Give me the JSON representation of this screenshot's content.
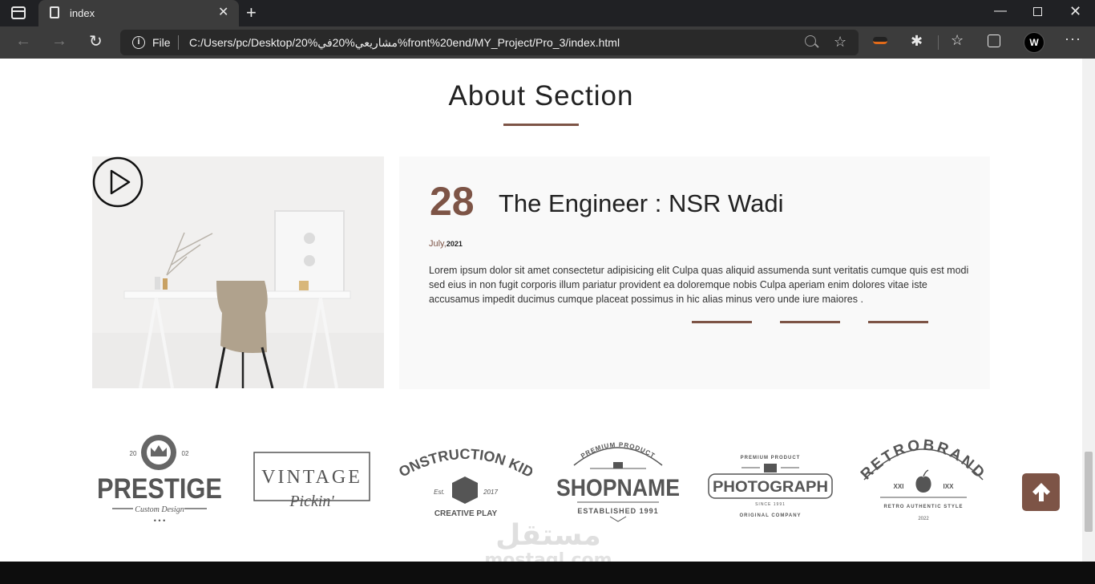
{
  "browser": {
    "tab_title": "index",
    "site_label": "File",
    "url": "C:/Users/pc/Desktop/20%مشاريعي%20في%front%20end/MY_Project/Pro_3/index.html",
    "profile_initial": "W"
  },
  "page": {
    "section_title": "About Section",
    "card": {
      "day": "28",
      "heading": "The Engineer : NSR Wadi",
      "month": "July,",
      "year": "2021",
      "text": "Lorem ipsum dolor sit amet consectetur adipisicing elit Culpa quas aliquid assumenda sunt veritatis cumque quis est modi sed eius in non fugit corporis illum pariatur provident ea doloremque nobis Culpa aperiam enim dolores vitae iste accusamus impedit ducimus cumque placeat possimus in hic alias minus vero unde iure maiores ."
    },
    "logos": [
      {
        "name": "PRESTIGE",
        "sub": "Custom Design",
        "top_left": "20",
        "top_right": "02"
      },
      {
        "name": "VINTAGE",
        "sub": "Pickin'"
      },
      {
        "name": "CONSTRUCTION KIDS",
        "est": "Est.",
        "year": "2017",
        "sub": "CREATIVE PLAY"
      },
      {
        "name": "SHOPNAME",
        "top": "PREMIUM PRODUCT",
        "sub": "ESTABLISHED 1991"
      },
      {
        "name": "PHOTOGRAPH",
        "top": "PREMIUM PRODUCT",
        "mid": "SINCE 1991",
        "sub": "ORIGINAL COMPANY"
      },
      {
        "name": "RETROBRAND",
        "left": "XXI",
        "right": "IXX",
        "sub": "RETRO AUTHENTIC STYLE",
        "bottom": "2022"
      }
    ],
    "watermark": {
      "arabic": "مستقل",
      "latin": "mostaql.com"
    }
  },
  "colors": {
    "accent": "#7d5446",
    "footer": "#0d0d0d"
  }
}
